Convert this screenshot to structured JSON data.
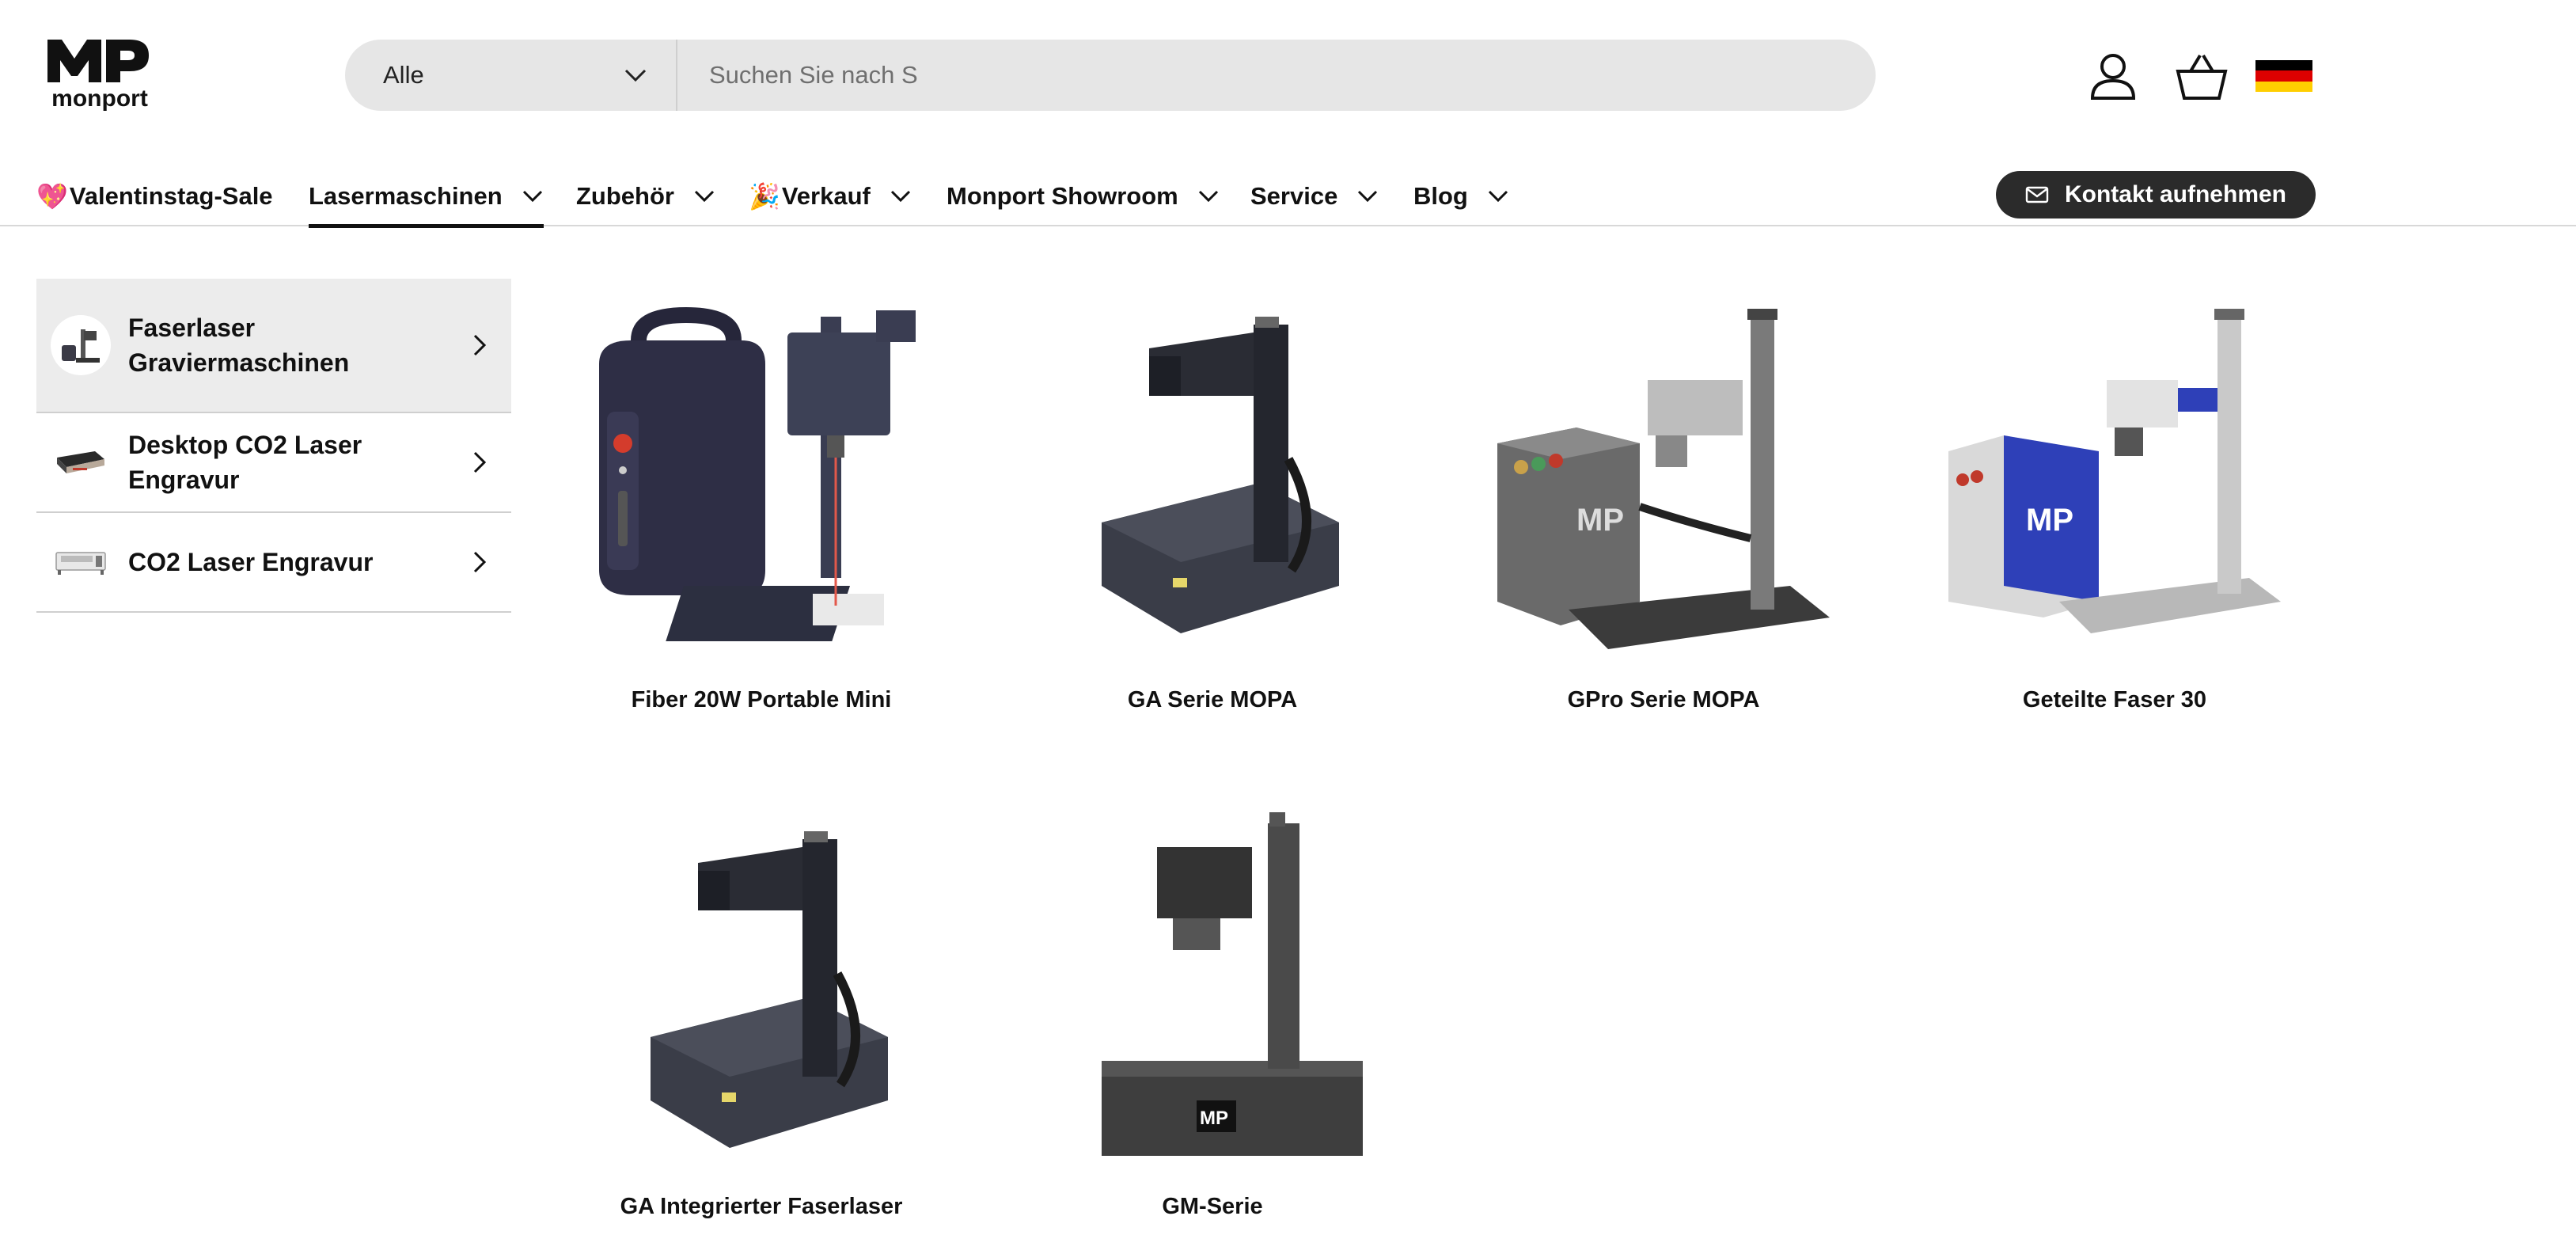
{
  "brand": {
    "name": "monport"
  },
  "search": {
    "category": "Alle",
    "placeholder": "Suchen Sie nach S"
  },
  "header_icons": [
    "account-icon",
    "cart-icon",
    "german-flag-icon"
  ],
  "nav": {
    "items": [
      {
        "emoji": "💖",
        "label": "Valentinstag-Sale",
        "dropdown": false
      },
      {
        "label": "Lasermaschinen",
        "dropdown": true,
        "active": true
      },
      {
        "label": "Zubehör",
        "dropdown": true
      },
      {
        "emoji": "🎉",
        "label": "Verkauf",
        "dropdown": true
      },
      {
        "label": "Monport Showroom",
        "dropdown": true
      },
      {
        "label": "Service",
        "dropdown": true
      },
      {
        "label": "Blog",
        "dropdown": true
      }
    ],
    "contact_label": "Kontakt aufnehmen"
  },
  "menu": {
    "categories": [
      {
        "label": "Faserlaser Graviermaschinen",
        "active": true
      },
      {
        "label": "Desktop CO2 Laser Engravur"
      },
      {
        "label": "CO2 Laser Engravur"
      }
    ],
    "products": [
      {
        "name": "Fiber 20W Portable Mini"
      },
      {
        "name": "GA Serie MOPA"
      },
      {
        "name": "GPro Serie MOPA"
      },
      {
        "name": "Geteilte Faser 30"
      },
      {
        "name": "GA Integrierter Faserlaser"
      },
      {
        "name": "GM-Serie"
      }
    ]
  },
  "colors": {
    "search_bg": "#e6e6e6",
    "contact_bg": "#2b2b2b",
    "active_category_bg": "#ececec",
    "flag": [
      "#000000",
      "#dd0000",
      "#ffce00"
    ]
  }
}
